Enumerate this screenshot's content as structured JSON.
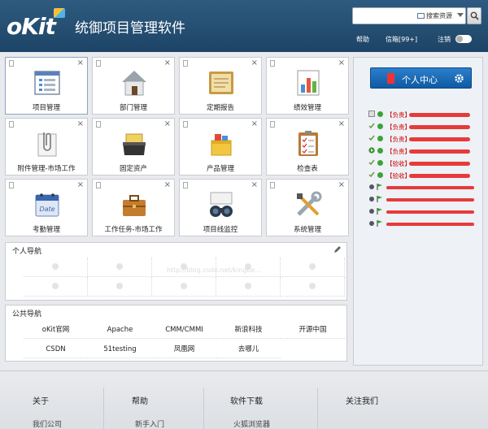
{
  "header": {
    "logo_text": "oKit",
    "title": "统御项目管理软件",
    "search": {
      "placeholder": "",
      "scope": "搜索资源"
    },
    "links": {
      "help": "帮助",
      "messages": "信箱[99+]",
      "logout": "注销"
    }
  },
  "modules": [
    {
      "label": "项目管理",
      "icon": "project-window-icon"
    },
    {
      "label": "部门管理",
      "icon": "house-icon"
    },
    {
      "label": "定期报告",
      "icon": "notebook-icon"
    },
    {
      "label": "绩效管理",
      "icon": "bar-chart-icon"
    },
    {
      "label": "附件管理-市场工作",
      "icon": "paperclip-icon"
    },
    {
      "label": "固定资产",
      "icon": "inbox-tray-icon"
    },
    {
      "label": "产品管理",
      "icon": "product-box-icon"
    },
    {
      "label": "检查表",
      "icon": "checklist-icon"
    },
    {
      "label": "考勤管理",
      "icon": "calendar-icon"
    },
    {
      "label": "工作任务-市场工作",
      "icon": "briefcase-icon"
    },
    {
      "label": "项目线监控",
      "icon": "binoculars-icon"
    },
    {
      "label": "系统管理",
      "icon": "tools-icon"
    }
  ],
  "personal_nav": {
    "title": "个人导航"
  },
  "public_nav": {
    "title": "公共导航",
    "links": [
      "oKit官网",
      "Apache",
      "CMM/CMMI",
      "新浪科技",
      "开源中国",
      "CSDN",
      "51testing",
      "凤凰网",
      "去哪儿"
    ]
  },
  "sidebar": {
    "center_button": "个人中心",
    "tasks": [
      {
        "tag": "【负责】",
        "kind": "edit"
      },
      {
        "tag": "【负责】",
        "kind": "check"
      },
      {
        "tag": "【负责】",
        "kind": "check"
      },
      {
        "tag": "【负责】",
        "kind": "play"
      },
      {
        "tag": "【验收】",
        "kind": "check"
      },
      {
        "tag": "【验收】",
        "kind": "check"
      },
      {
        "tag": "",
        "kind": "flag"
      },
      {
        "tag": "",
        "kind": "flag"
      },
      {
        "tag": "",
        "kind": "flag"
      },
      {
        "tag": "",
        "kind": "flag"
      }
    ]
  },
  "watermark": "http://blog.csdn.net/kingbe...",
  "footer": {
    "columns": [
      "关于",
      "帮助",
      "软件下载",
      "关注我们"
    ],
    "subs": [
      "我们公司",
      "新手入门",
      "火狐浏览器"
    ]
  },
  "colors": {
    "header": "#1f4a6e",
    "accent": "#1a6bbd",
    "task_red": "#e63b3b",
    "task_green": "#3aa33a"
  }
}
